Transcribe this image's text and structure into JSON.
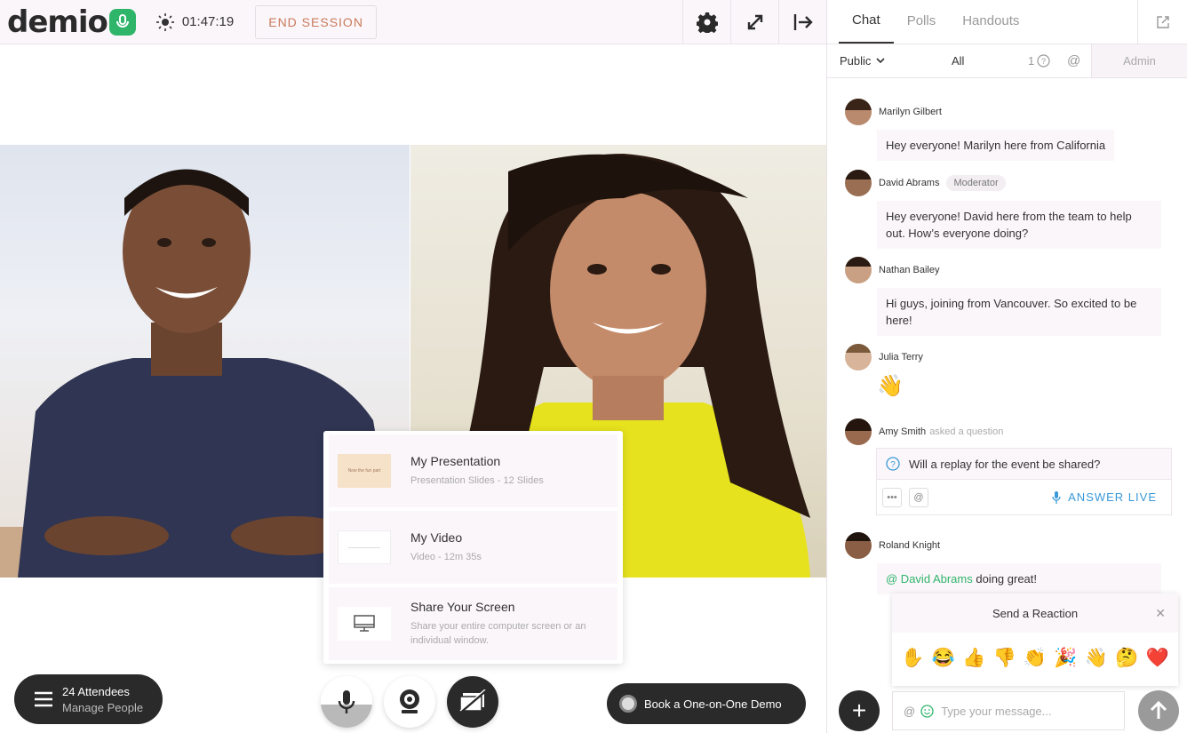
{
  "app": {
    "logo": "demio",
    "timer": "01:47:19",
    "end_session": "END SESSION"
  },
  "media_menu": [
    {
      "title": "My Presentation",
      "sub": "Presentation Slides - 12 Slides",
      "thumb_text": "Now the fun part"
    },
    {
      "title": "My Video",
      "sub": "Video - 12m 35s"
    },
    {
      "title": "Share Your Screen",
      "sub": "Share your entire computer screen or an individual window."
    }
  ],
  "attendees": {
    "count": "24 Attendees",
    "manage": "Manage People"
  },
  "book_demo": "Book a One-on-One Demo",
  "panel": {
    "tabs": [
      "Chat",
      "Polls",
      "Handouts"
    ],
    "filters": {
      "public": "Public",
      "all": "All",
      "questions": "1",
      "at": "@",
      "admin": "Admin"
    }
  },
  "messages": [
    {
      "name": "Marilyn Gilbert",
      "text": "Hey everyone! Marilyn here from California"
    },
    {
      "name": "David Abrams",
      "badge": "Moderator",
      "text": "Hey everyone! David here from the team to help out. How’s everyone doing?"
    },
    {
      "name": "Nathan Bailey",
      "text": "Hi guys, joining from Vancouver. So excited to be here!"
    },
    {
      "name": "Julia Terry",
      "text": "👋"
    },
    {
      "name": "Amy Smith",
      "asked": "asked a question",
      "text": "Will a replay for the event be shared?",
      "answer_live": "ANSWER LIVE"
    },
    {
      "name": "Roland Knight",
      "mention": "@ David Abrams",
      "text": " doing great!"
    }
  ],
  "reaction": {
    "title": "Send a Reaction",
    "emojis": [
      "✋",
      "😂",
      "👍",
      "👎",
      "👏",
      "🎉",
      "👋",
      "🤔",
      "❤️"
    ]
  },
  "composer": {
    "placeholder": "Type your message..."
  }
}
